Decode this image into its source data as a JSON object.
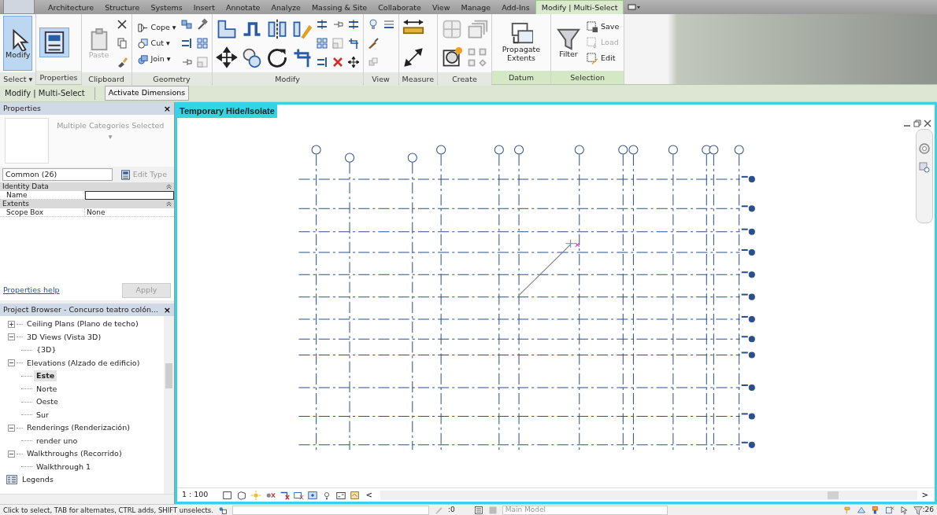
{
  "ribbon_tabs": [
    {
      "label": "Architecture",
      "selected": false
    },
    {
      "label": "Structure",
      "selected": false
    },
    {
      "label": "Systems",
      "selected": false
    },
    {
      "label": "Insert",
      "selected": false
    },
    {
      "label": "Annotate",
      "selected": false
    },
    {
      "label": "Analyze",
      "selected": false
    },
    {
      "label": "Massing & Site",
      "selected": false
    },
    {
      "label": "Collaborate",
      "selected": false
    },
    {
      "label": "View",
      "selected": false
    },
    {
      "label": "Manage",
      "selected": false
    },
    {
      "label": "Add-Ins",
      "selected": false
    },
    {
      "label": "Modify | Multi-Select",
      "selected": true
    }
  ],
  "ribbon_panels": [
    {
      "label": "Select ▾",
      "tools": [
        {
          "kind": "large",
          "label": "Modify",
          "active": true
        }
      ]
    },
    {
      "label": "Properties"
    },
    {
      "label": "Clipboard",
      "tools": [
        {
          "kind": "large",
          "label": "Paste",
          "disabled": true
        }
      ]
    },
    {
      "label": "Geometry",
      "tools": [
        {
          "kind": "small",
          "label": "Cope ▾"
        },
        {
          "kind": "small",
          "label": "Cut ▾"
        },
        {
          "kind": "small",
          "label": "Join ▾"
        }
      ]
    },
    {
      "label": "Modify"
    },
    {
      "label": "View"
    },
    {
      "label": "Measure"
    },
    {
      "label": "Create"
    },
    {
      "label": "Datum",
      "tools": [
        {
          "kind": "large",
          "label": "Propagate Extents"
        }
      ]
    },
    {
      "label": "Selection",
      "tools": [
        {
          "kind": "large",
          "label": "Filter"
        },
        {
          "kind": "small",
          "label": "Save"
        },
        {
          "kind": "small",
          "label": "Load",
          "disabled": true
        },
        {
          "kind": "small",
          "label": "Edit"
        }
      ]
    }
  ],
  "options_bar": {
    "context": "Modify | Multi-Select",
    "button": "Activate Dimensions"
  },
  "properties": {
    "title": "Properties",
    "close": "×",
    "type_selector": "Multiple Categories Selected ▾",
    "filter": "Common (26)",
    "edit_type": "Edit Type",
    "groups": [
      {
        "label": "Identity Data",
        "rows": [
          {
            "name": "Name",
            "kind": "input"
          }
        ]
      },
      {
        "label": "Extents",
        "rows": [
          {
            "name": "Scope Box",
            "value": "None",
            "kind": "text"
          }
        ]
      }
    ],
    "help_link": "Properties help",
    "apply": "Apply"
  },
  "project_browser": {
    "title": "Project Browser - Concurso teatro colón...",
    "close": "×",
    "items": [
      {
        "kind": "group",
        "label": "Ceiling Plans (Plano de techo)",
        "expanded": false
      },
      {
        "kind": "group",
        "label": "3D Views (Vista 3D)",
        "expanded": true,
        "children": [
          {
            "label": "{3D}",
            "selected": false
          }
        ]
      },
      {
        "kind": "group",
        "label": "Elevations (Alzado de edificio)",
        "expanded": true,
        "children": [
          {
            "label": "Este",
            "selected": true
          },
          {
            "label": "Norte",
            "selected": false
          },
          {
            "label": "Oeste",
            "selected": false
          },
          {
            "label": "Sur",
            "selected": false
          }
        ]
      },
      {
        "kind": "group",
        "label": "Renderings (Renderización)",
        "expanded": true,
        "children": [
          {
            "label": "render uno",
            "selected": false
          }
        ]
      },
      {
        "kind": "group",
        "label": "Walkthroughs (Recorrido)",
        "expanded": true,
        "children": [
          {
            "label": "Walkthrough 1",
            "selected": false
          }
        ]
      },
      {
        "kind": "legend",
        "label": "Legends"
      }
    ]
  },
  "view": {
    "label": "Temporary Hide/Isolate",
    "scale": "1 : 100",
    "scroll_left": "<",
    "scroll_right": ">"
  },
  "status_bar": {
    "message": "Click to select, TAB for alternates, CTRL adds, SHIFT unselects.",
    "design_option_count": ":0",
    "workset": "Main Model",
    "filter_count": ":26"
  }
}
